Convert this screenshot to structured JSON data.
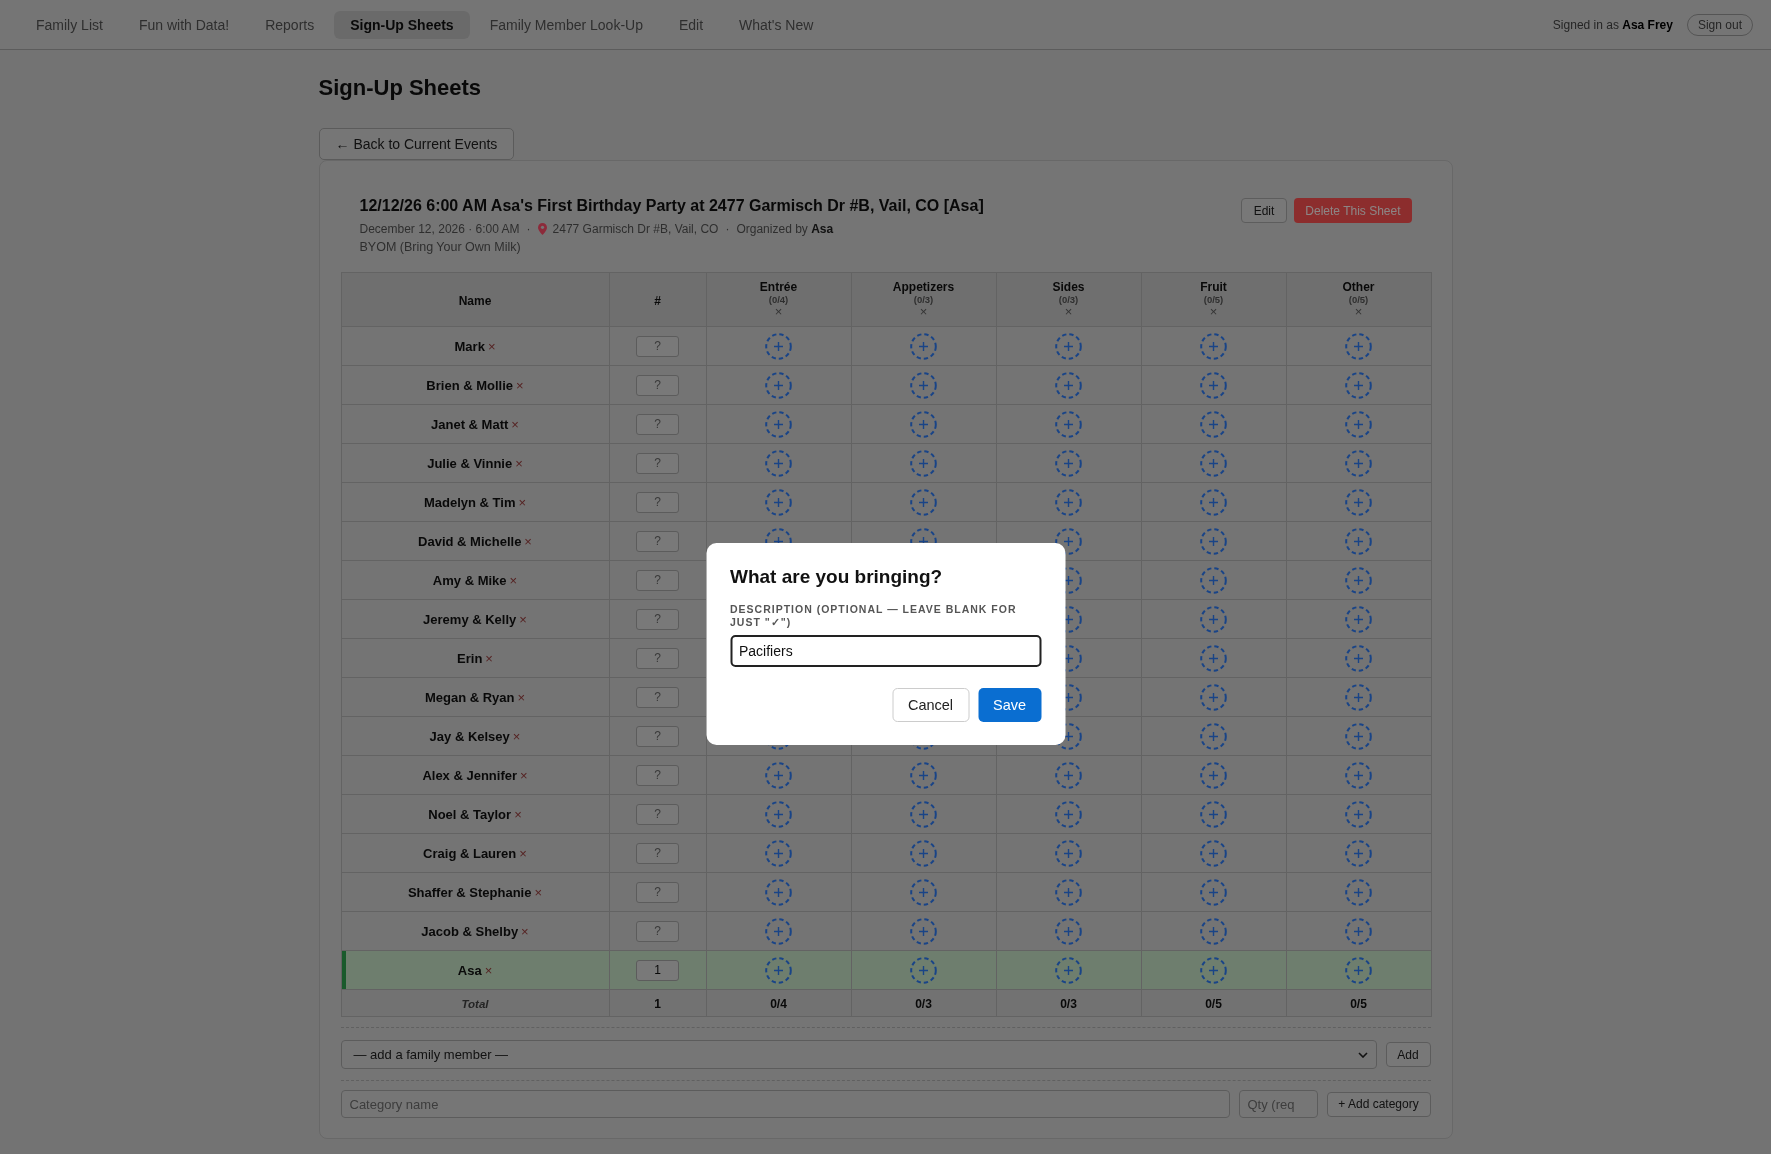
{
  "nav": {
    "items": [
      {
        "label": "Family List",
        "selected": false
      },
      {
        "label": "Fun with Data!",
        "selected": false
      },
      {
        "label": "Reports",
        "selected": false
      },
      {
        "label": "Sign-Up Sheets",
        "selected": true
      },
      {
        "label": "Family Member Look-Up",
        "selected": false
      },
      {
        "label": "Edit",
        "selected": false
      },
      {
        "label": "What's New",
        "selected": false
      }
    ],
    "signed_in": "Signed in as **Asa Frey**",
    "sign_out_button": "Sign out"
  },
  "page_title": "Sign-Up Sheets",
  "back_button": "← Back to Current Events",
  "sheet": {
    "title": "12/12/26 6:00 AM Asa's First Birthday Party at 2477 Garmisch Dr #B, Vail, CO [Asa]",
    "edit_button": "Edit",
    "delete_button": "Delete This Sheet",
    "meta": [
      {
        "kind": "date",
        "text": "December 12, 2026 · 6:00 AM"
      },
      {
        "kind": "separator",
        "text": "·"
      },
      {
        "kind": "location",
        "text": "2477 Garmisch Dr #B, Vail, CO"
      },
      {
        "kind": "separator",
        "text": "·"
      },
      {
        "kind": "organizer",
        "text": "Organized by **Asa**"
      }
    ],
    "description": "BYOM (Bring Your Own Milk)"
  },
  "table": {
    "name_column": "Name",
    "qty_column": "#",
    "categories": [
      {
        "name": "Entrée",
        "count": "(0/4)",
        "remove": "×"
      },
      {
        "name": "Appetizers",
        "count": "(0/3)",
        "remove": "×"
      },
      {
        "name": "Sides",
        "count": "(0/3)",
        "remove": "×"
      },
      {
        "name": "Fruit",
        "count": "(0/5)",
        "remove": "×"
      },
      {
        "name": "Other",
        "count": "(0/5)",
        "remove": "×"
      }
    ],
    "rows": [
      {
        "name": "Mark",
        "remove": "×",
        "qty": {
          "placeholder": "?"
        },
        "highlighted": false
      },
      {
        "name": "Brien & Mollie",
        "remove": "×",
        "qty": {
          "placeholder": "?"
        },
        "highlighted": false
      },
      {
        "name": "Janet & Matt",
        "remove": "×",
        "qty": {
          "placeholder": "?"
        },
        "highlighted": false
      },
      {
        "name": "Julie & Vinnie",
        "remove": "×",
        "qty": {
          "placeholder": "?"
        },
        "highlighted": false
      },
      {
        "name": "Madelyn & Tim",
        "remove": "×",
        "qty": {
          "placeholder": "?"
        },
        "highlighted": false
      },
      {
        "name": "David & Michelle",
        "remove": "×",
        "qty": {
          "placeholder": "?"
        },
        "highlighted": false
      },
      {
        "name": "Amy & Mike",
        "remove": "×",
        "qty": {
          "placeholder": "?"
        },
        "highlighted": false
      },
      {
        "name": "Jeremy & Kelly",
        "remove": "×",
        "qty": {
          "placeholder": "?"
        },
        "highlighted": false
      },
      {
        "name": "Erin",
        "remove": "×",
        "qty": {
          "placeholder": "?"
        },
        "highlighted": false
      },
      {
        "name": "Megan & Ryan",
        "remove": "×",
        "qty": {
          "placeholder": "?"
        },
        "highlighted": false
      },
      {
        "name": "Jay & Kelsey",
        "remove": "×",
        "qty": {
          "placeholder": "?"
        },
        "highlighted": false
      },
      {
        "name": "Alex & Jennifer",
        "remove": "×",
        "qty": {
          "placeholder": "?"
        },
        "highlighted": false
      },
      {
        "name": "Noel & Taylor",
        "remove": "×",
        "qty": {
          "placeholder": "?"
        },
        "highlighted": false
      },
      {
        "name": "Craig & Lauren",
        "remove": "×",
        "qty": {
          "placeholder": "?"
        },
        "highlighted": false
      },
      {
        "name": "Shaffer & Stephanie",
        "remove": "×",
        "qty": {
          "placeholder": "?"
        },
        "highlighted": false
      },
      {
        "name": "Jacob & Shelby",
        "remove": "×",
        "qty": {
          "placeholder": "?"
        },
        "highlighted": false
      },
      {
        "name": "Asa",
        "remove": "×",
        "qty": {
          "value": "1"
        },
        "highlighted": true
      }
    ],
    "total_row": {
      "label": "Total",
      "qty": "1",
      "counts": [
        "0/4",
        "0/3",
        "0/3",
        "0/5",
        "0/5"
      ]
    }
  },
  "add_member": {
    "select": "— add a family member —",
    "button": "Add"
  },
  "add_category": {
    "name_field": {
      "placeholder": "Category name"
    },
    "qty_field": {
      "placeholder": "Qty (req"
    },
    "button": "+ Add category"
  },
  "modal": {
    "title": "What are you bringing?",
    "label": "DESCRIPTION (OPTIONAL — LEAVE BLANK FOR JUST \"✓\")",
    "input": {
      "value": "Pacifiers"
    },
    "cancel_button": "Cancel",
    "save_button": "Save"
  }
}
